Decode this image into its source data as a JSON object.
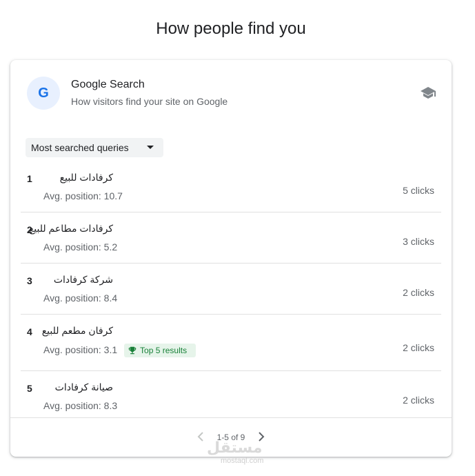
{
  "page": {
    "title": "How people find you"
  },
  "card": {
    "logo_letter": "G",
    "title": "Google Search",
    "subtitle": "How visitors find your site on Google"
  },
  "dropdown": {
    "selected": "Most searched queries"
  },
  "rows": [
    {
      "rank": "1",
      "query": "كرفادات للبيع",
      "avg": "Avg. position: 10.7",
      "clicks": "5 clicks"
    },
    {
      "rank": "2",
      "query": "كرفادات مطاعم للبيع",
      "avg": "Avg. position: 5.2",
      "clicks": "3 clicks"
    },
    {
      "rank": "3",
      "query": "شركة كرفادات",
      "avg": "Avg. position: 8.4",
      "clicks": "2 clicks"
    },
    {
      "rank": "4",
      "query": "كرفان مطعم للبيع",
      "avg": "Avg. position: 3.1",
      "badge": "Top 5 results",
      "clicks": "2 clicks"
    },
    {
      "rank": "5",
      "query": "صيانة كرفادات",
      "avg": "Avg. position: 8.3",
      "clicks": "2 clicks"
    }
  ],
  "pager": {
    "label": "1-5 of 9"
  },
  "watermark": {
    "text": "مستقل",
    "sub": "mostaql.com"
  },
  "colors": {
    "accent": "#1a73e8",
    "badge_bg": "#e6f4ea",
    "badge_text": "#188038"
  },
  "icons": {
    "header": "graduation-cap-icon",
    "badge": "trophy-icon"
  }
}
